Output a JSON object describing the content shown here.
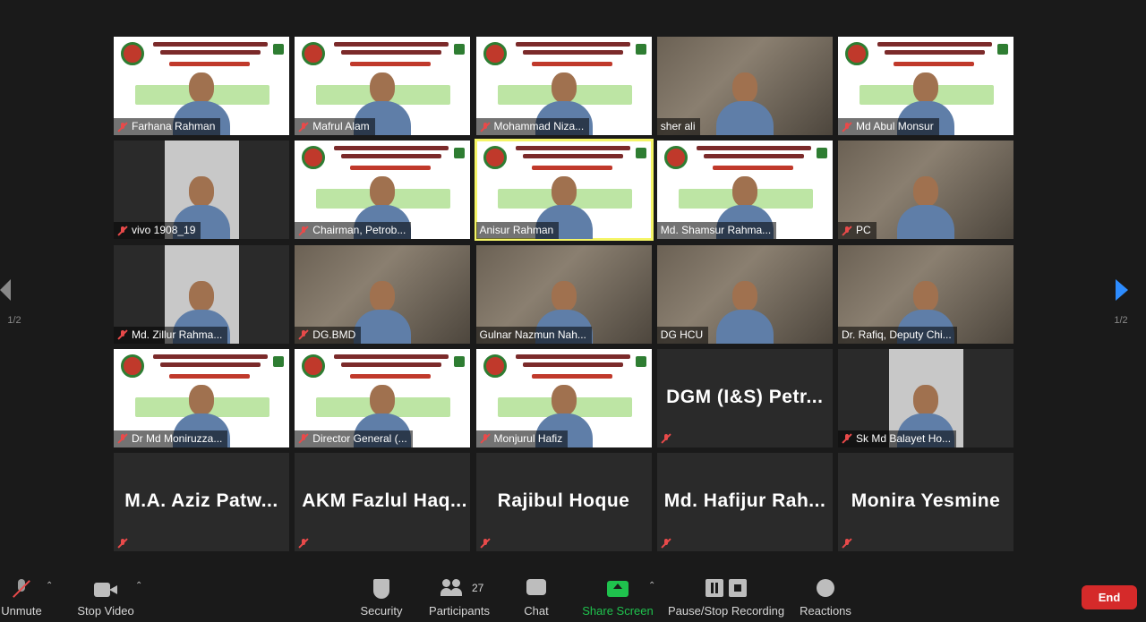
{
  "pager": {
    "left_label": "1/2",
    "right_label": "1/2"
  },
  "gallery": {
    "tiles": [
      {
        "name": "Farhana Rahman",
        "muted": true,
        "kind": "slide"
      },
      {
        "name": "Mafrul Alam",
        "muted": true,
        "kind": "slide"
      },
      {
        "name": "Mohammad Niza...",
        "muted": true,
        "kind": "slide"
      },
      {
        "name": "sher ali",
        "muted": false,
        "kind": "photo"
      },
      {
        "name": "Md Abul Monsur",
        "muted": true,
        "kind": "slide"
      },
      {
        "name": "vivo 1908_19",
        "muted": true,
        "kind": "portrait"
      },
      {
        "name": "Chairman, Petrob...",
        "muted": true,
        "kind": "slide"
      },
      {
        "name": "Anisur Rahman",
        "muted": false,
        "kind": "slide",
        "active": true
      },
      {
        "name": "Md. Shamsur Rahma...",
        "muted": false,
        "kind": "slide"
      },
      {
        "name": "PC",
        "muted": true,
        "kind": "photo"
      },
      {
        "name": "Md. Zillur Rahma...",
        "muted": true,
        "kind": "portrait"
      },
      {
        "name": "DG.BMD",
        "muted": true,
        "kind": "photo"
      },
      {
        "name": "Gulnar Nazmun Nah...",
        "muted": false,
        "kind": "photo"
      },
      {
        "name": "DG HCU",
        "muted": false,
        "kind": "photo"
      },
      {
        "name": "Dr. Rafiq, Deputy Chi...",
        "muted": false,
        "kind": "photo"
      },
      {
        "name": "Dr Md Moniruzza...",
        "muted": true,
        "kind": "slide"
      },
      {
        "name": "Director General (...",
        "muted": true,
        "kind": "slide"
      },
      {
        "name": "Monjurul Hafiz",
        "muted": true,
        "kind": "slide"
      },
      {
        "name": "DGM (I&S) Petr...",
        "muted": true,
        "kind": "nameonly"
      },
      {
        "name": "Sk Md Balayet Ho...",
        "muted": true,
        "kind": "portrait"
      },
      {
        "name": "M.A. Aziz Patw...",
        "muted": true,
        "kind": "nameonly"
      },
      {
        "name": "AKM Fazlul Haq...",
        "muted": true,
        "kind": "nameonly"
      },
      {
        "name": "Rajibul Hoque",
        "muted": true,
        "kind": "nameonly"
      },
      {
        "name": "Md. Hafijur Rah...",
        "muted": true,
        "kind": "nameonly"
      },
      {
        "name": "Monira Yesmine",
        "muted": true,
        "kind": "nameonly"
      }
    ]
  },
  "toolbar": {
    "unmute": "Unmute",
    "stop_video": "Stop Video",
    "security": "Security",
    "participants": "Participants",
    "participants_count": "27",
    "chat": "Chat",
    "share_screen": "Share Screen",
    "recording": "Pause/Stop Recording",
    "reactions": "Reactions",
    "end": "End"
  },
  "colors": {
    "accent": "#2d8cff",
    "share_green": "#1fc24d",
    "end_red": "#d52a2a",
    "active_border": "#f5f567",
    "muted_red": "#e84a4a"
  }
}
